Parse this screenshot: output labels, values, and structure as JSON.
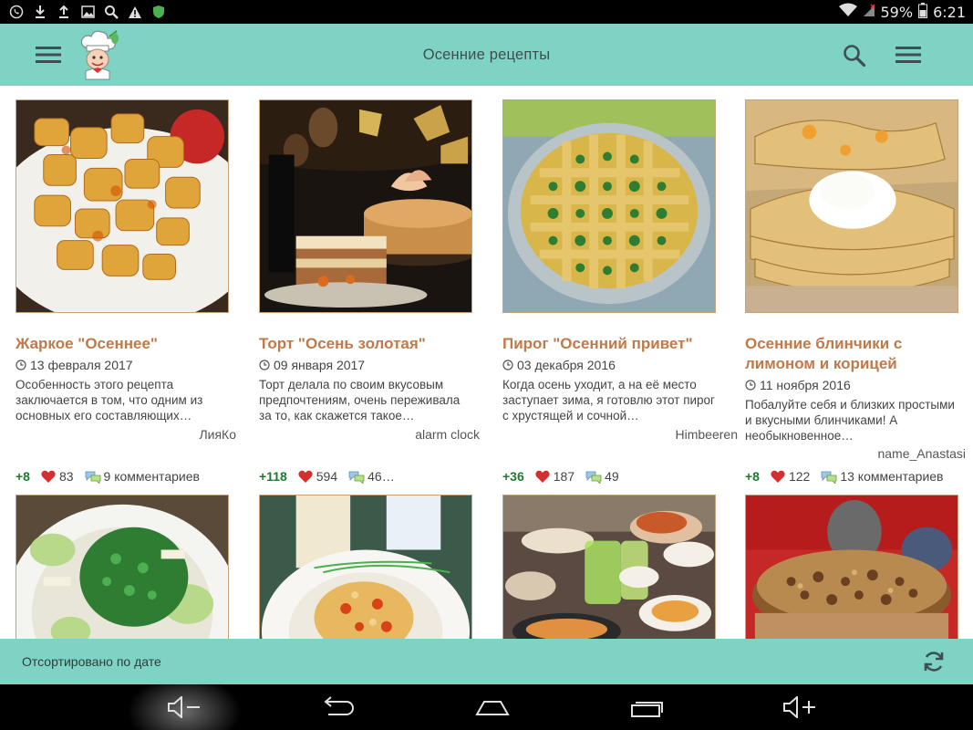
{
  "status_bar": {
    "battery": "59%",
    "time": "6:21",
    "left_icons": [
      "viber-icon",
      "download-icon",
      "upload-icon",
      "image-icon",
      "search-icon",
      "warning-icon",
      "shield-icon"
    ]
  },
  "app_bar": {
    "title": "Осенние рецепты",
    "icons": [
      "hamburger-menu-icon",
      "chef-logo-icon",
      "search-icon",
      "overflow-menu-icon"
    ]
  },
  "colors": {
    "accent": "#7fd3c5",
    "title_brown": "#c07a4a",
    "plus_green": "#1f7a2f",
    "heart_red": "#d32f2f"
  },
  "recipes": [
    {
      "title": "Жаркое \"Осеннее\"",
      "date": "13 февраля 2017",
      "description": "Особенность этого рецепта заключается в том, что одним из основных его составляющих…",
      "author": "ЛияКо",
      "plus": "+8",
      "likes": "83",
      "comments": "9 комментариев",
      "photo": "potato-stew"
    },
    {
      "title": "Торт \"Осень золотая\"",
      "date": "09 января 2017",
      "description": "Торт делала по своим вкусовым предпочтениям, очень переживала за то, как скажется такое…",
      "author": "alarm clock",
      "plus": "+118",
      "likes": "594",
      "comments": "46…",
      "photo": "autumn-cake"
    },
    {
      "title": "Пирог \"Осенний привет\"",
      "date": "03 декабря 2016",
      "description": "Когда осень уходит, а на её место заступает зима, я готовлю этот пирог с хрустящей и сочной…",
      "author": "Himbeeren",
      "plus": "+36",
      "likes": "187",
      "comments": "49",
      "photo": "lattice-pie"
    },
    {
      "title": "Осенние блинчики с лимоном и корицей",
      "date": "11 ноября 2016",
      "description": "Побалуйте себя и близких простыми и вкусными блинчиками! А необыкновенное…",
      "author": "name_Anastasi",
      "plus": "+8",
      "likes": "122",
      "comments": "13 комментариев",
      "photo": "pancakes"
    },
    {
      "photo": "green-salad"
    },
    {
      "photo": "rice-plate"
    },
    {
      "photo": "table-spread"
    },
    {
      "photo": "nut-cake"
    }
  ],
  "sort_bar": {
    "label": "Отсортировано по дате",
    "icon": "refresh-icon"
  },
  "nav_bar": {
    "icons": [
      "volume-down-icon",
      "back-icon",
      "home-icon",
      "recent-apps-icon",
      "volume-up-icon"
    ]
  }
}
